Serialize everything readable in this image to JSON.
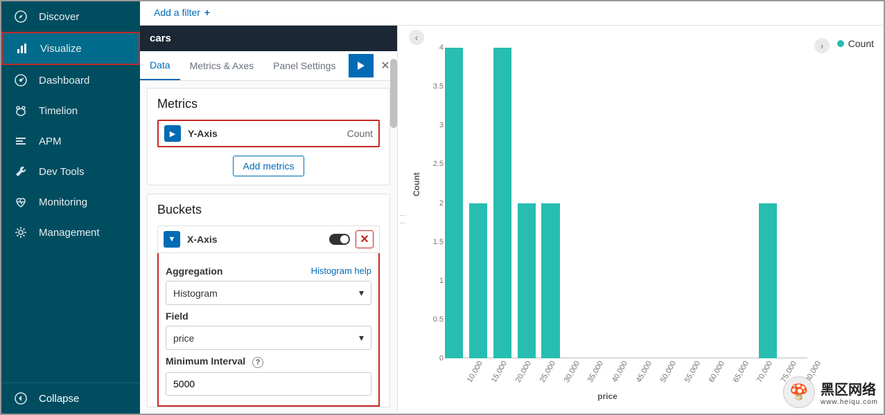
{
  "sidebar": {
    "items": [
      {
        "label": "Discover",
        "icon": "compass-icon"
      },
      {
        "label": "Visualize",
        "icon": "bar-chart-icon"
      },
      {
        "label": "Dashboard",
        "icon": "gauge-icon"
      },
      {
        "label": "Timelion",
        "icon": "bear-icon"
      },
      {
        "label": "APM",
        "icon": "list-icon"
      },
      {
        "label": "Dev Tools",
        "icon": "wrench-icon"
      },
      {
        "label": "Monitoring",
        "icon": "heartbeat-icon"
      },
      {
        "label": "Management",
        "icon": "gear-icon"
      }
    ],
    "collapse_label": "Collapse"
  },
  "filter": {
    "add_label": "Add a filter"
  },
  "index": {
    "name": "cars"
  },
  "tabs": {
    "data": "Data",
    "metrics_axes": "Metrics & Axes",
    "panel_settings": "Panel Settings"
  },
  "metrics": {
    "title": "Metrics",
    "yaxis_label": "Y-Axis",
    "yaxis_value": "Count",
    "add_label": "Add metrics"
  },
  "buckets": {
    "title": "Buckets",
    "xaxis_label": "X-Axis",
    "aggregation_label": "Aggregation",
    "help_link": "Histogram help",
    "aggregation_value": "Histogram",
    "field_label": "Field",
    "field_value": "price",
    "interval_label": "Minimum Interval",
    "interval_value": "5000"
  },
  "chart_data": {
    "type": "bar",
    "legend": "Count",
    "ylabel": "Count",
    "xlabel": "price",
    "ylim": [
      0,
      4
    ],
    "yticks": [
      0,
      0.5,
      1,
      1.5,
      2,
      2.5,
      3,
      3.5,
      4
    ],
    "categories": [
      "10,000",
      "15,000",
      "20,000",
      "25,000",
      "30,000",
      "35,000",
      "40,000",
      "45,000",
      "50,000",
      "55,000",
      "60,000",
      "65,000",
      "70,000",
      "75,000",
      "80,000"
    ],
    "values": [
      4,
      2,
      4,
      2,
      2,
      0,
      0,
      0,
      0,
      0,
      0,
      0,
      0,
      2,
      0
    ],
    "color": "#27bdb0"
  },
  "watermark": {
    "text": "黑区网络",
    "sub": "www.heiqu.com"
  }
}
